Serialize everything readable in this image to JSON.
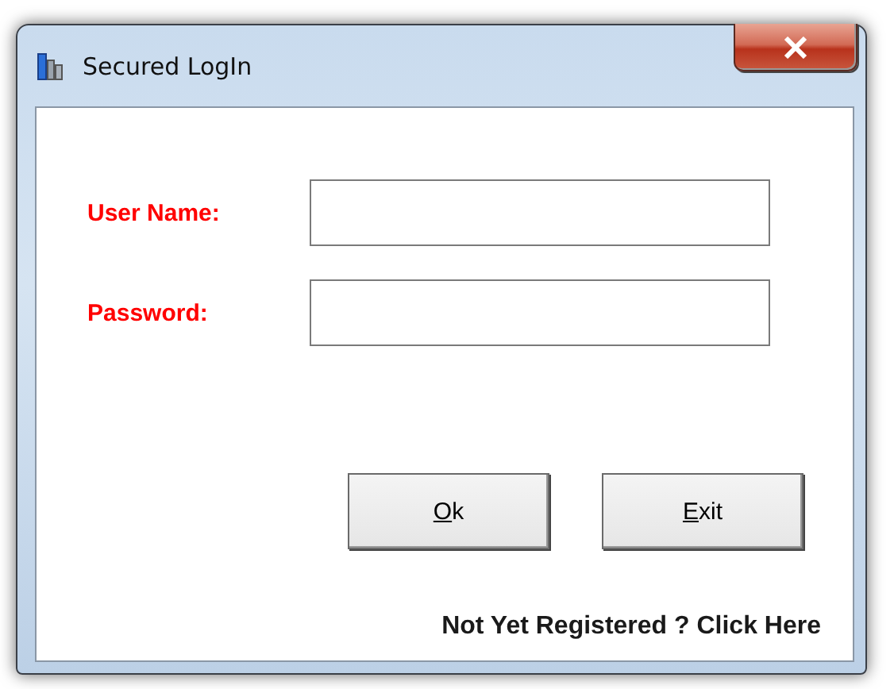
{
  "window": {
    "title": "Secured LogIn"
  },
  "fields": [
    {
      "label": "User Name:"
    },
    {
      "label": "Password:"
    }
  ],
  "buttons": [
    {
      "label": "Ok",
      "underline_first": true
    },
    {
      "label": "Exit",
      "underline_first": true
    }
  ],
  "link": "Not Yet Registered ? Click Here"
}
